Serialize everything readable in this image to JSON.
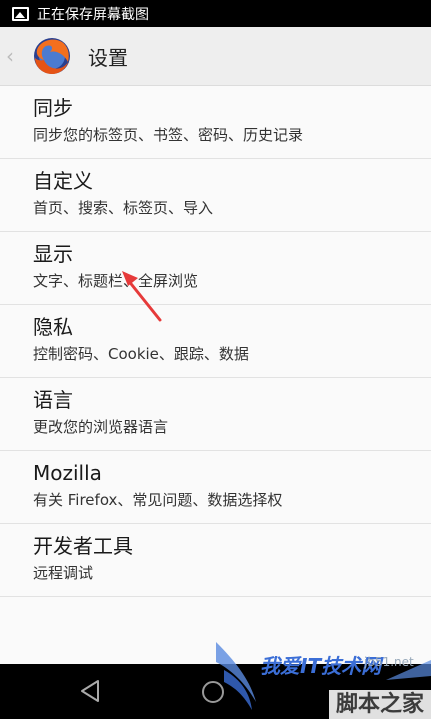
{
  "status_bar": {
    "text": "正在保存屏幕截图"
  },
  "app_bar": {
    "title": "设置"
  },
  "settings": [
    {
      "title": "同步",
      "summary": "同步您的标签页、书签、密码、历史记录"
    },
    {
      "title": "自定义",
      "summary": "首页、搜索、标签页、导入"
    },
    {
      "title": "显示",
      "summary": "文字、标题栏、全屏浏览"
    },
    {
      "title": "隐私",
      "summary": "控制密码、Cookie、跟踪、数据"
    },
    {
      "title": "语言",
      "summary": "更改您的浏览器语言"
    },
    {
      "title": "Mozilla",
      "summary": "有关 Firefox、常见问题、数据选择权"
    },
    {
      "title": "开发者工具",
      "summary": "远程调试"
    }
  ],
  "watermark": {
    "brand": "我爱IT技术网",
    "url": "jb51.net",
    "site": "脚本之家"
  },
  "colors": {
    "status_bar": "#000000",
    "app_bar": "#eeeeee",
    "arrow": "#e63a3a"
  }
}
